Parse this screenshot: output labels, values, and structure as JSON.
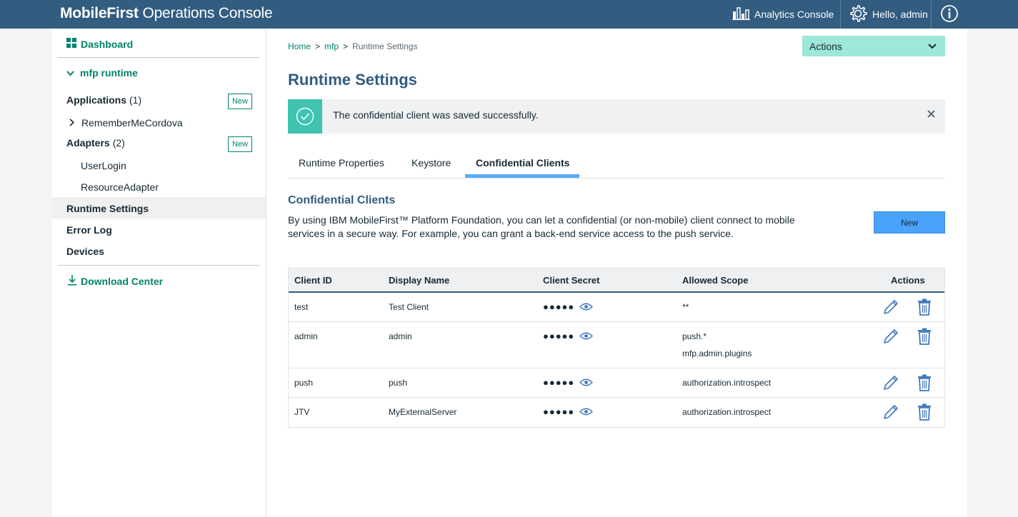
{
  "header": {
    "brand_bold": "MobileFirst",
    "brand_rest": " Operations Console",
    "analytics_label": "Analytics Console",
    "user_label": "Hello, admin"
  },
  "sidebar": {
    "dashboard": "Dashboard",
    "runtime": "mfp runtime",
    "applications_label": "Applications",
    "applications_count": "(1)",
    "applications_new": "New",
    "app_item": "RememberMeCordova",
    "adapters_label": "Adapters",
    "adapters_count": "(2)",
    "adapters_new": "New",
    "adapter_items": [
      "UserLogin",
      "ResourceAdapter"
    ],
    "runtime_settings": "Runtime Settings",
    "error_log": "Error Log",
    "devices": "Devices",
    "download_center": "Download Center"
  },
  "breadcrumb": {
    "home": "Home",
    "mfp": "mfp",
    "current": "Runtime Settings",
    "separator": ">"
  },
  "actions_dropdown": "Actions",
  "page_title": "Runtime Settings",
  "notification": "The confidential client was saved successfully.",
  "tabs": [
    "Runtime Properties",
    "Keystore",
    "Confidential Clients"
  ],
  "active_tab": "Confidential Clients",
  "section": {
    "title": "Confidential Clients",
    "description": "By using IBM MobileFirst™ Platform Foundation, you can let a confidential (or non-mobile) client connect to mobile services in a secure way. For example, you can grant a back-end service access to the push service.",
    "new_button": "New"
  },
  "table": {
    "columns": [
      "Client ID",
      "Display Name",
      "Client Secret",
      "Allowed Scope",
      "Actions"
    ],
    "rows": [
      {
        "client_id": "test",
        "display_name": "Test Client",
        "secret": "●●●●●",
        "scope": [
          "**"
        ]
      },
      {
        "client_id": "admin",
        "display_name": "admin",
        "secret": "●●●●●",
        "scope": [
          "push.*",
          "mfp.admin.plugins"
        ]
      },
      {
        "client_id": "push",
        "display_name": "push",
        "secret": "●●●●●",
        "scope": [
          "authorization.introspect"
        ]
      },
      {
        "client_id": "JTV",
        "display_name": "MyExternalServer",
        "secret": "●●●●●",
        "scope": [
          "authorization.introspect"
        ]
      }
    ]
  },
  "colors": {
    "header_bg": "#325c80",
    "accent_green": "#00846a",
    "actions_bg": "#9de8d8",
    "success": "#3ec4b0",
    "tab_active": "#5aaafa",
    "button_blue": "#4aa3fa",
    "icon_blue": "#4178be"
  },
  "icons": {
    "analytics": "bar-chart-icon",
    "settings": "gear-icon",
    "info": "info-icon",
    "dashboard": "grid-icon",
    "expand": "chevron-down-icon",
    "app_expand": "chevron-right-icon",
    "download": "download-icon",
    "success": "checkmark-icon",
    "close": "close-icon",
    "reveal": "eye-icon",
    "edit": "pencil-icon",
    "delete": "trash-icon"
  }
}
